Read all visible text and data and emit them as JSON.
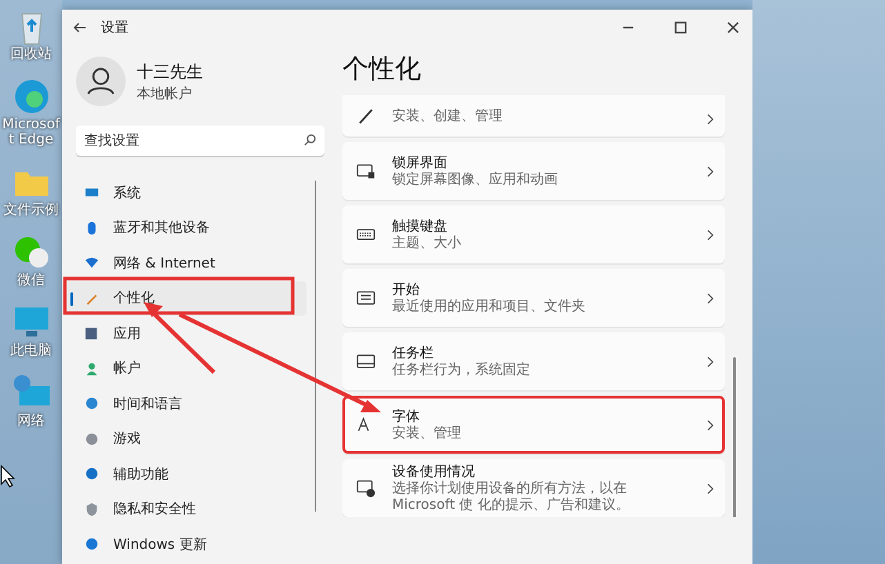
{
  "desktop_icons": [
    {
      "kind": "recycle",
      "label": "回收站"
    },
    {
      "kind": "edge",
      "label": "Microsoft Edge"
    },
    {
      "kind": "folder",
      "label": "文件示例"
    },
    {
      "kind": "wechat",
      "label": "微信"
    },
    {
      "kind": "pc",
      "label": "此电脑"
    },
    {
      "kind": "network",
      "label": "网络"
    }
  ],
  "window": {
    "title": "设置"
  },
  "profile": {
    "name": "十三先生",
    "subtitle": "本地帐户"
  },
  "search": {
    "placeholder": "查找设置"
  },
  "sidebar": {
    "items": [
      {
        "kind": "system",
        "label": "系统",
        "selected": false
      },
      {
        "kind": "bluetooth",
        "label": "蓝牙和其他设备",
        "selected": false
      },
      {
        "kind": "network",
        "label": "网络 & Internet",
        "selected": false
      },
      {
        "kind": "personalize",
        "label": "个性化",
        "selected": true
      },
      {
        "kind": "apps",
        "label": "应用",
        "selected": false
      },
      {
        "kind": "account",
        "label": "帐户",
        "selected": false
      },
      {
        "kind": "time",
        "label": "时间和语言",
        "selected": false
      },
      {
        "kind": "game",
        "label": "游戏",
        "selected": false
      },
      {
        "kind": "access",
        "label": "辅助功能",
        "selected": false
      },
      {
        "kind": "privacy",
        "label": "隐私和安全性",
        "selected": false
      },
      {
        "kind": "update",
        "label": "Windows 更新",
        "selected": false
      }
    ]
  },
  "page_title": "个性化",
  "cards": [
    {
      "kind": "brush",
      "subtitle": "安装、创建、管理",
      "highlighted": false
    },
    {
      "kind": "lock",
      "title": "锁屏界面",
      "subtitle": "锁定屏幕图像、应用和动画",
      "highlighted": false
    },
    {
      "kind": "keyboard",
      "title": "触摸键盘",
      "subtitle": "主题、大小",
      "highlighted": false
    },
    {
      "kind": "start",
      "title": "开始",
      "subtitle": "最近使用的应用和项目、文件夹",
      "highlighted": false
    },
    {
      "kind": "taskbar",
      "title": "任务栏",
      "subtitle": "任务栏行为，系统固定",
      "highlighted": false
    },
    {
      "kind": "font",
      "title": "字体",
      "subtitle": "安装、管理",
      "highlighted": true
    },
    {
      "kind": "usage",
      "title": "设备使用情况",
      "subtitle": "选择你计划使用设备的所有方法，以在 Microsoft 使 化的提示、广告和建议。",
      "highlighted": false
    }
  ]
}
